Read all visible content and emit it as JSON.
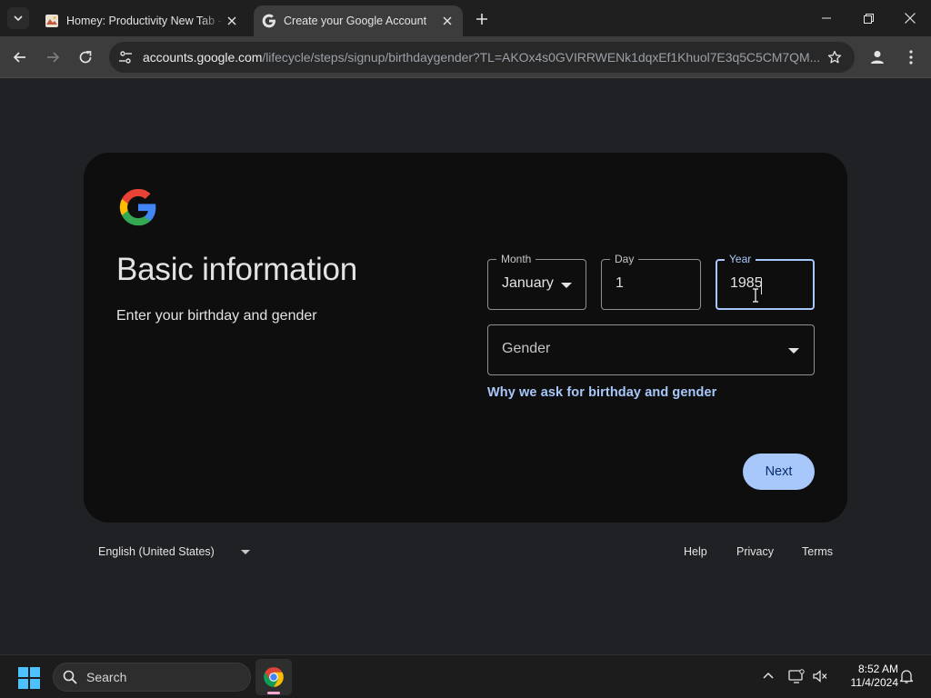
{
  "browser": {
    "tabs": [
      {
        "title": "Homey: Productivity New Tab -",
        "active": false
      },
      {
        "title": "Create your Google Account",
        "active": true
      }
    ],
    "url_host": "accounts.google.com",
    "url_path": "/lifecycle/steps/signup/birthdaygender?TL=AKOx4s0GVIRRWENk1dqxEf1Khuol7E3q5C5CM7QM..."
  },
  "signup": {
    "heading": "Basic information",
    "subheading": "Enter your birthday and gender",
    "month": {
      "label": "Month",
      "value": "January"
    },
    "day": {
      "label": "Day",
      "value": "1"
    },
    "year": {
      "label": "Year",
      "value": "1985"
    },
    "gender": {
      "placeholder": "Gender"
    },
    "why_link": "Why we ask for birthday and gender",
    "next_label": "Next"
  },
  "footer": {
    "language": "English (United States)",
    "help": "Help",
    "privacy": "Privacy",
    "terms": "Terms"
  },
  "taskbar": {
    "search_label": "Search",
    "time": "8:52 AM",
    "date": "11/4/2024"
  },
  "colors": {
    "accent": "#a8c7fa",
    "card_bg": "#0e0e0e",
    "page_bg": "#202124",
    "google_blue": "#4285f4",
    "google_red": "#ea4335",
    "google_yellow": "#fbbc05",
    "google_green": "#34a853"
  }
}
